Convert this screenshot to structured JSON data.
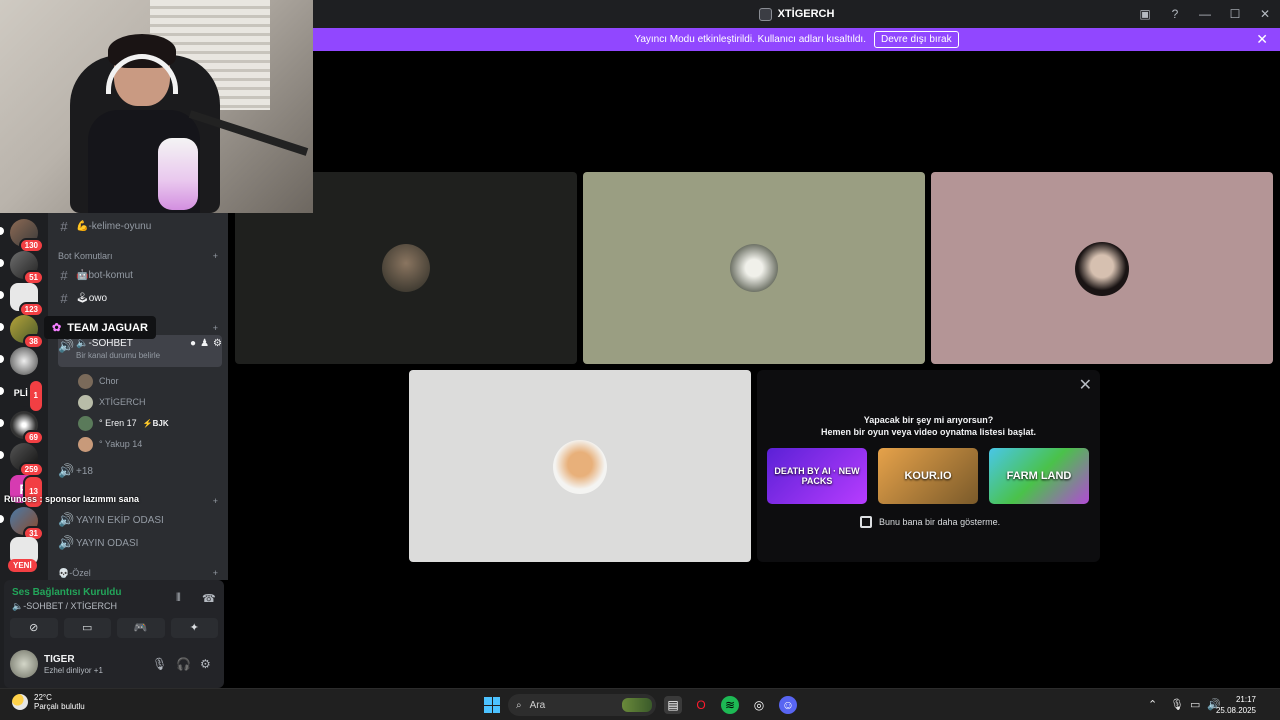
{
  "window": {
    "title": "XTİGERCH"
  },
  "banner": {
    "message": "Yayıncı Modu etkinleştirildi. Kullanıcı adları kısaltıldı.",
    "button_label": "Devre dışı bırak",
    "close_icon": "✕"
  },
  "servers": {
    "badges": [
      "130",
      "51",
      "123",
      "38",
      "",
      "1",
      "69",
      "259",
      "13",
      "31",
      ""
    ],
    "text_server": "PLİC",
    "new_label": "YENİ"
  },
  "tooltip": {
    "name": "TEAM JAGUAR"
  },
  "channels": {
    "top_channel": "💪-kelime-oyunu",
    "bot_category": "Bot Komutları",
    "bot_channel": "🤖bot-komut",
    "owo_channel": "🕹owo",
    "active_voice": "🔈-SOHBET",
    "active_voice_status": "Bir kanal durumu belirle",
    "users": [
      {
        "name": "Chor"
      },
      {
        "name": "XTİGERCH"
      },
      {
        "name": "° Eren 17",
        "tag": "⚡BJK"
      },
      {
        "name": "° Yakup 14"
      }
    ],
    "more_users": "+18",
    "ekip": "YAYIN EKİP ODASI",
    "yayin": "YAYIN ODASI",
    "ozel_category": "💀-Özel"
  },
  "chat_ticker": "Runoss : sponsor lazımmı sana",
  "voice": {
    "status": "Ses Bağlantısı Kuruldu",
    "location": "🔈-SOHBET / XTİGERCH"
  },
  "user": {
    "name": "TIGER",
    "activity": "Ezhel dinliyor +1"
  },
  "activity_card": {
    "line1": "Yapacak bir şey mi arıyorsun?",
    "line2": "Hemen bir oyun veya video oynatma listesi başlat.",
    "games": [
      {
        "label": "DEATH BY AI · NEW PACKS",
        "color": "#7b2ff7"
      },
      {
        "label": "KOUR.IO",
        "color": "#c98a2a"
      },
      {
        "label": "FARM LAND",
        "color": "#35b24a"
      }
    ],
    "checkbox_label": "Bunu bana bir daha gösterme."
  },
  "taskbar": {
    "temp": "22°C",
    "weather": "Parçalı bulutlu",
    "search_placeholder": "Ara",
    "time": "21:17",
    "date": "25.08.2025"
  },
  "colors": {
    "accent": "#9147ff",
    "online": "#23a55a",
    "badge": "#f23f43"
  }
}
